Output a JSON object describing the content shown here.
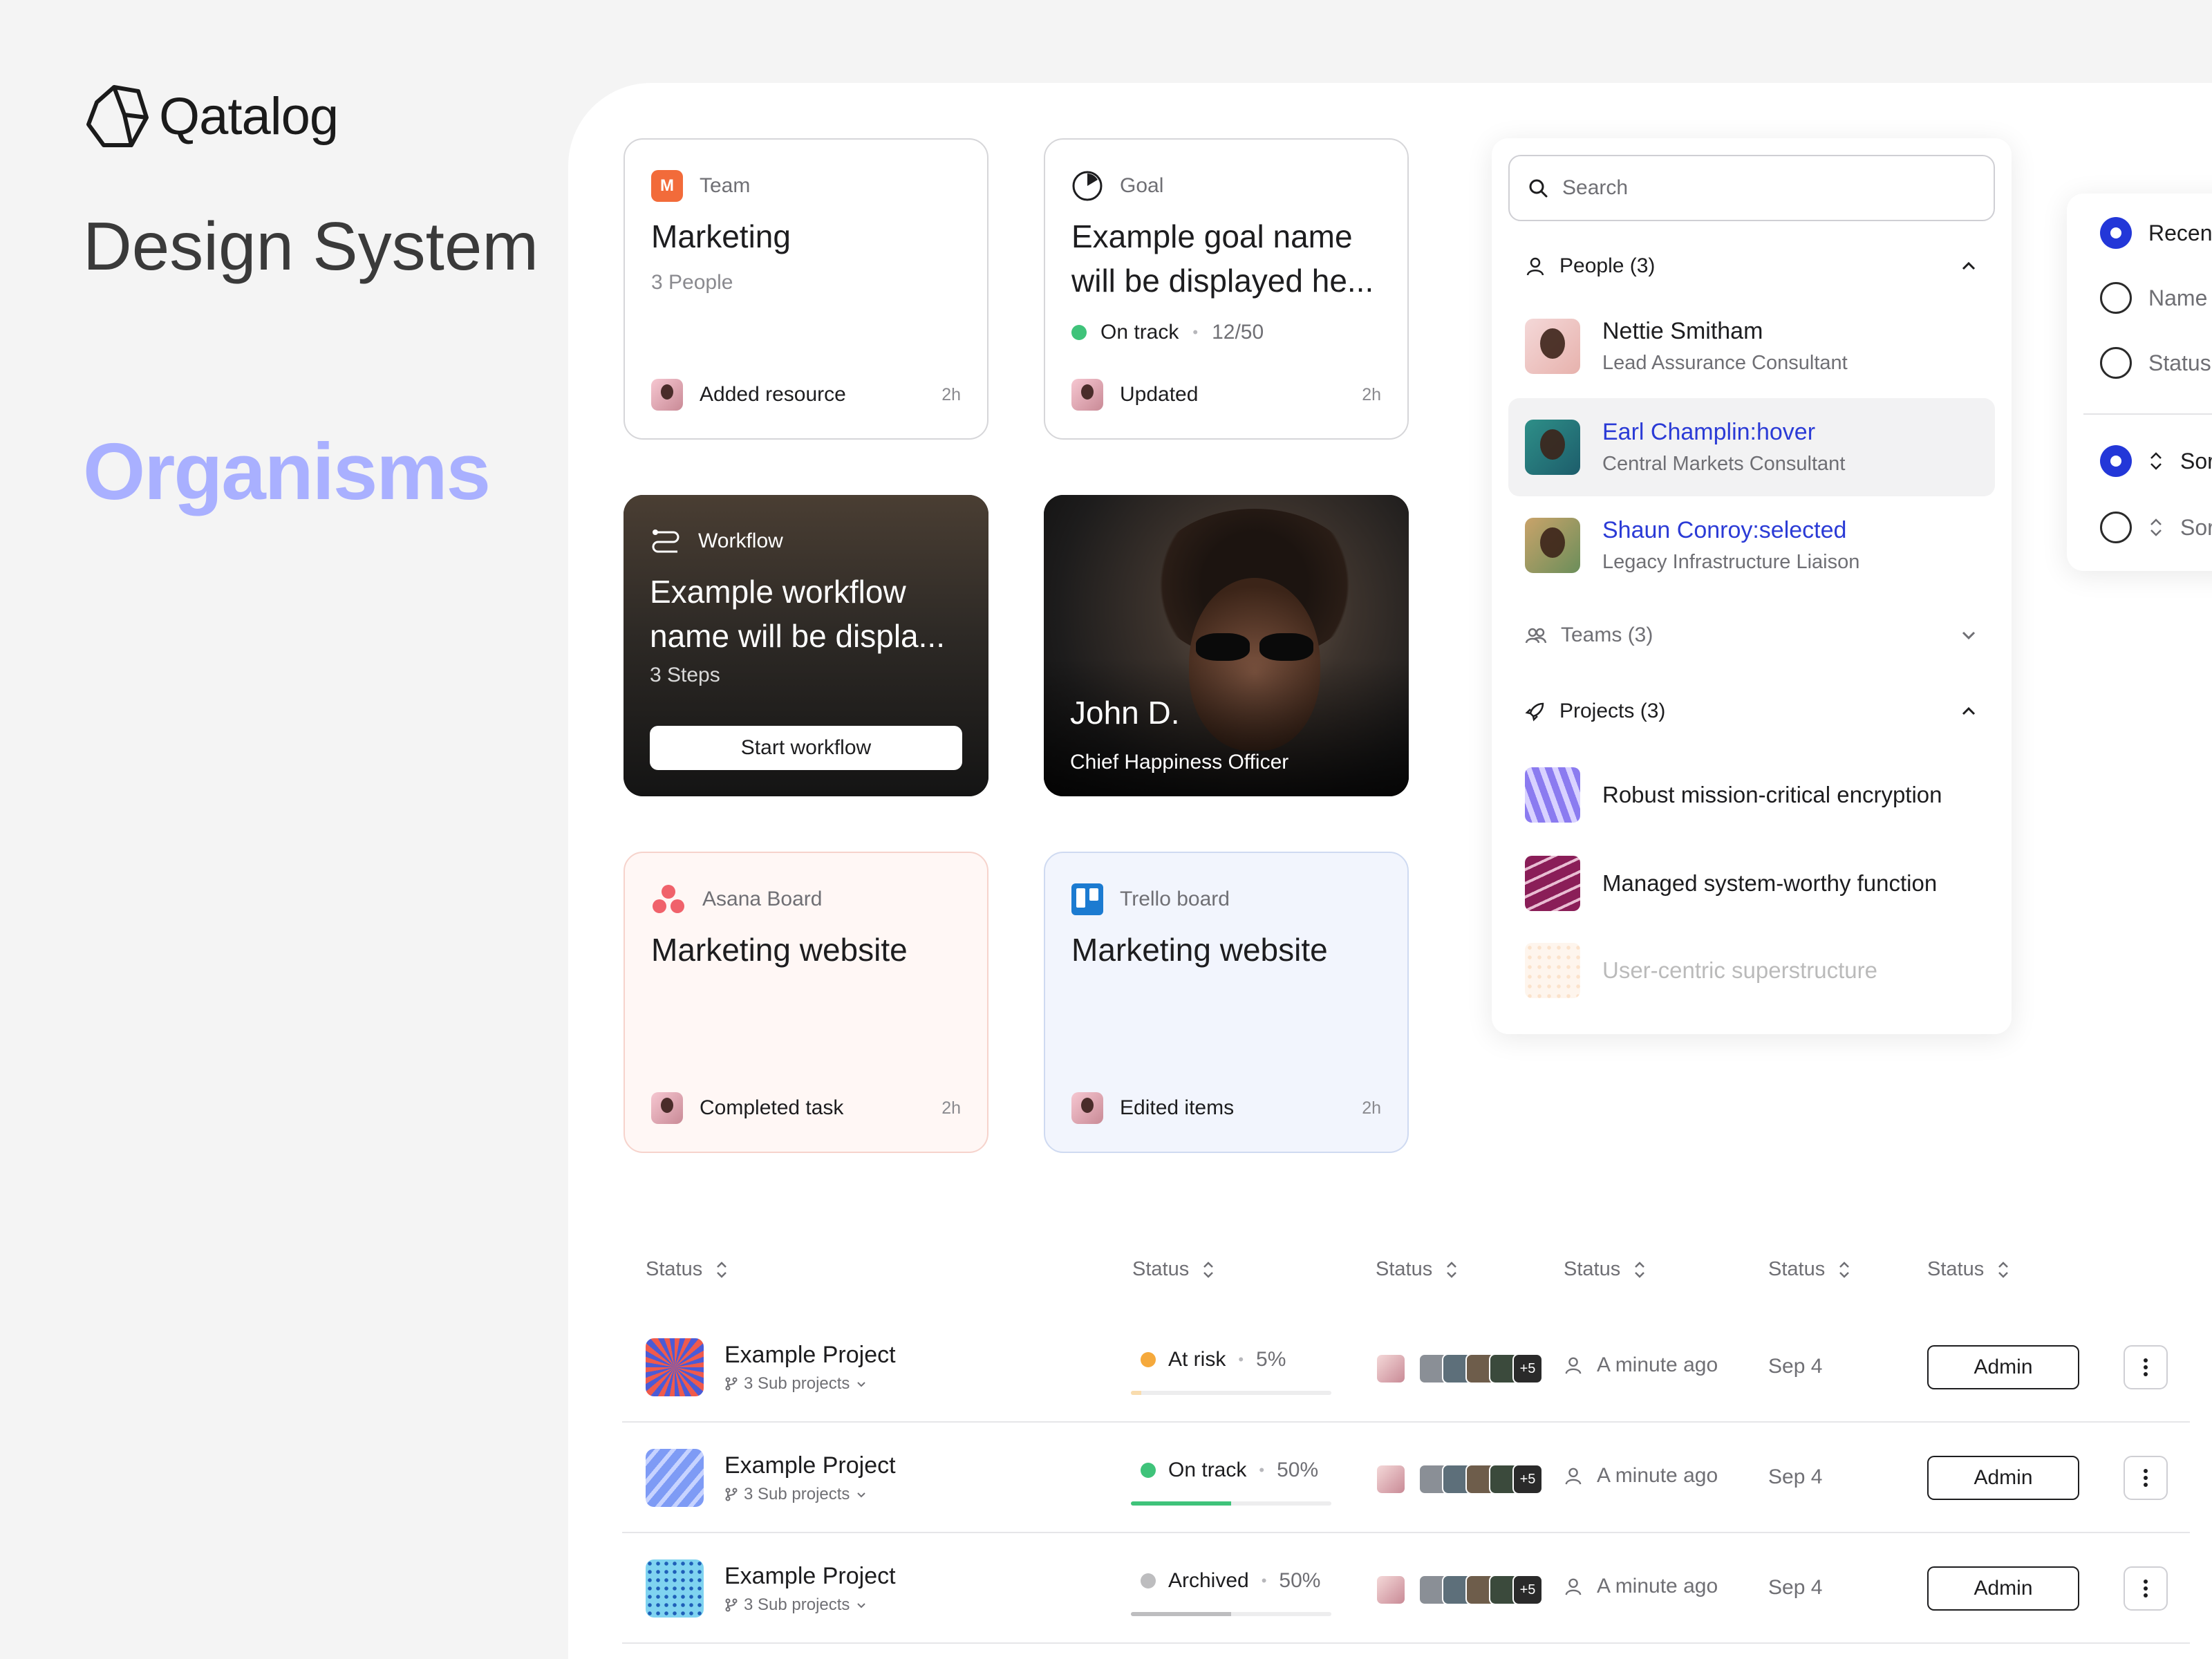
{
  "brand": {
    "name": "Qatalog"
  },
  "page": {
    "title_design": "Design System",
    "title_section": "Organisms"
  },
  "cards": {
    "team": {
      "kind": "Team",
      "badge": "M",
      "title": "Marketing",
      "subtitle": "3 People",
      "activity": "Added resource",
      "time": "2h"
    },
    "goal": {
      "kind": "Goal",
      "title": "Example goal name will be displayed he...",
      "status": "On track",
      "progress": "12/50",
      "activity": "Updated",
      "time": "2h"
    },
    "workflow": {
      "kind": "Workflow",
      "title": "Example workflow name will be displa...",
      "subtitle": "3 Steps",
      "button": "Start workflow"
    },
    "person": {
      "name": "John D.",
      "role": "Chief Happiness Officer"
    },
    "asana": {
      "kind": "Asana Board",
      "title": "Marketing website",
      "activity": "Completed task",
      "time": "2h"
    },
    "trello": {
      "kind": "Trello board",
      "title": "Marketing website",
      "activity": "Edited items",
      "time": "2h"
    }
  },
  "search": {
    "placeholder": "Search",
    "people_label": "People (3)",
    "people": [
      {
        "name": "Nettie Smitham",
        "role": "Lead Assurance Consultant"
      },
      {
        "name": "Earl Champlin:hover",
        "role": "Central Markets Consultant"
      },
      {
        "name": "Shaun Conroy:selected",
        "role": "Legacy Infrastructure Liaison"
      }
    ],
    "teams_label": "Teams (3)",
    "projects_label": "Projects (3)",
    "projects": [
      "Robust mission-critical encryption",
      "Managed system-worthy function",
      "User-centric superstructure"
    ]
  },
  "filters": {
    "options": [
      "Recent",
      "Name",
      "Status"
    ],
    "sort_options": [
      "Sort",
      "Sort"
    ]
  },
  "table": {
    "headers": [
      "Status",
      "Status",
      "Status",
      "Status",
      "Status",
      "Status"
    ],
    "rows": [
      {
        "name": "Example Project",
        "sub": "3 Sub projects",
        "status": "At risk",
        "pct": "5%",
        "progress": 0.05,
        "status_color": "#f5a93c",
        "bar_color": "#f9dcae",
        "plus": "+5",
        "updated": "A minute ago",
        "date": "Sep 4",
        "role": "Admin"
      },
      {
        "name": "Example Project",
        "sub": "3 Sub projects",
        "status": "On track",
        "pct": "50%",
        "progress": 0.5,
        "status_color": "#3fc37a",
        "bar_color": "#3fc37a",
        "plus": "+5",
        "updated": "A minute ago",
        "date": "Sep 4",
        "role": "Admin"
      },
      {
        "name": "Example Project",
        "sub": "3 Sub projects",
        "status": "Archived",
        "pct": "50%",
        "progress": 0.5,
        "status_color": "#bdbdbf",
        "bar_color": "#bdbdbf",
        "plus": "+5",
        "updated": "A minute ago",
        "date": "Sep 4",
        "role": "Admin"
      }
    ]
  },
  "colors": {
    "accent": "#2337d8",
    "organisms": "#a9b0ff",
    "link": "#2b3bd6"
  }
}
